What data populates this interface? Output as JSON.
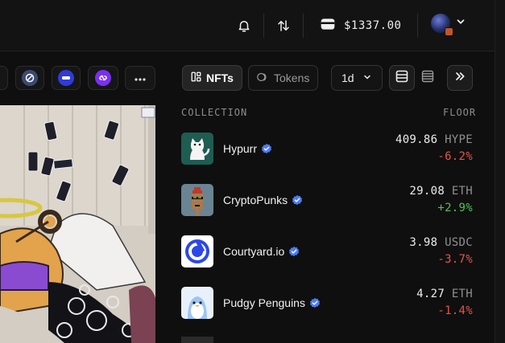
{
  "topbar": {
    "icons": [
      "bell-icon",
      "swap-icon",
      "wallet-icon",
      "chevron-down-icon"
    ],
    "balance": "$1337.00"
  },
  "filters": {
    "chain_chips": [
      "more-icon"
    ],
    "tabs": [
      {
        "label": "NFTs",
        "active": true
      },
      {
        "label": "Tokens",
        "active": false
      }
    ],
    "period": "1d"
  },
  "list": {
    "col_collection": "COLLECTION",
    "col_floor": "FLOOR",
    "items": [
      {
        "name": "Hypurr",
        "price": "409.86",
        "currency": "HYPE",
        "change": "-6.2%",
        "trend": "down"
      },
      {
        "name": "CryptoPunks",
        "price": "29.08",
        "currency": "ETH",
        "change": "+2.9%",
        "trend": "up"
      },
      {
        "name": "Courtyard.io",
        "price": "3.98",
        "currency": "USDC",
        "change": "-3.7%",
        "trend": "down"
      },
      {
        "name": "Pudgy Penguins",
        "price": "4.27",
        "currency": "ETH",
        "change": "-1.4%",
        "trend": "down"
      }
    ]
  },
  "colors": {
    "accent_blue": "#4c7cf5",
    "negative": "#e5534b",
    "positive": "#4cc35a"
  }
}
